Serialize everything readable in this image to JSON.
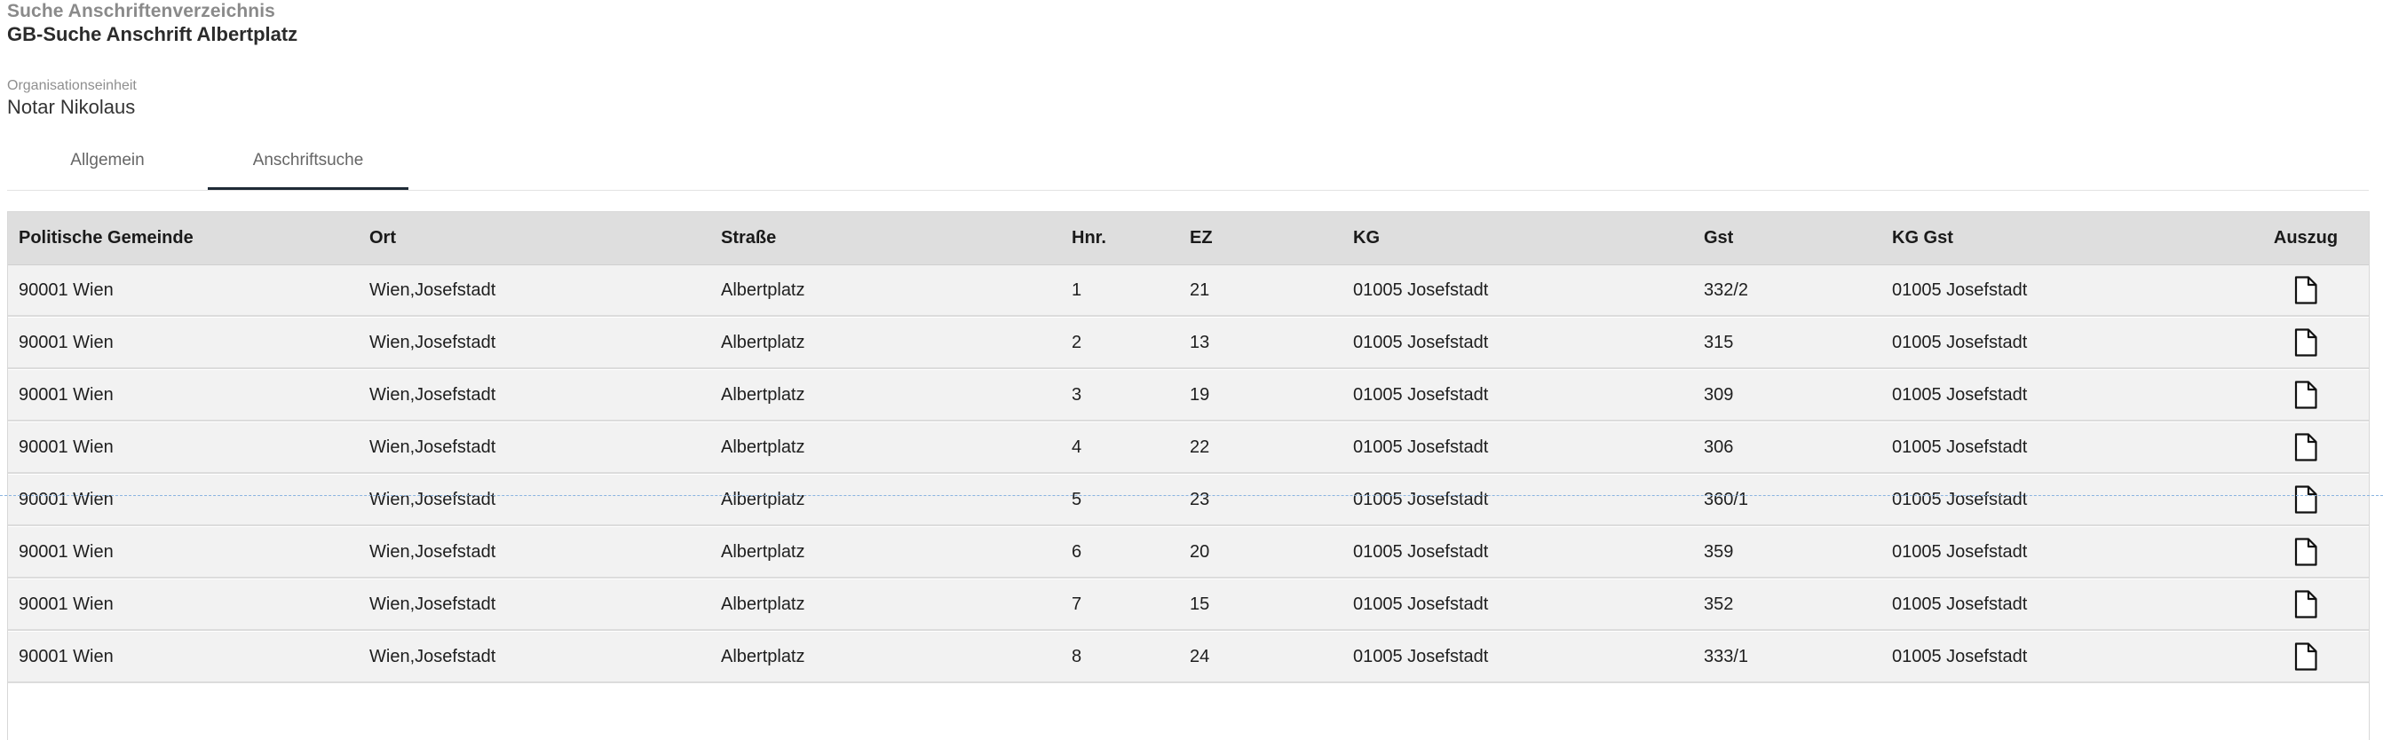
{
  "header": {
    "section": "Suche Anschriftenverzeichnis",
    "title": "GB-Suche Anschrift Albertplatz"
  },
  "org": {
    "label": "Organisationseinheit",
    "value": "Notar Nikolaus"
  },
  "tabs": [
    {
      "label": "Allgemein",
      "active": false
    },
    {
      "label": "Anschriftsuche",
      "active": true
    }
  ],
  "table": {
    "columns": [
      "Politische Gemeinde",
      "Ort",
      "Straße",
      "Hnr.",
      "EZ",
      "KG",
      "Gst",
      "KG Gst",
      "Auszug"
    ],
    "rows": [
      [
        "90001 Wien",
        "Wien,Josefstadt",
        "Albertplatz",
        "1",
        "21",
        "01005 Josefstadt",
        "332/2",
        "01005 Josefstadt"
      ],
      [
        "90001 Wien",
        "Wien,Josefstadt",
        "Albertplatz",
        "2",
        "13",
        "01005 Josefstadt",
        "315",
        "01005 Josefstadt"
      ],
      [
        "90001 Wien",
        "Wien,Josefstadt",
        "Albertplatz",
        "3",
        "19",
        "01005 Josefstadt",
        "309",
        "01005 Josefstadt"
      ],
      [
        "90001 Wien",
        "Wien,Josefstadt",
        "Albertplatz",
        "4",
        "22",
        "01005 Josefstadt",
        "306",
        "01005 Josefstadt"
      ],
      [
        "90001 Wien",
        "Wien,Josefstadt",
        "Albertplatz",
        "5",
        "23",
        "01005 Josefstadt",
        "360/1",
        "01005 Josefstadt"
      ],
      [
        "90001 Wien",
        "Wien,Josefstadt",
        "Albertplatz",
        "6",
        "20",
        "01005 Josefstadt",
        "359",
        "01005 Josefstadt"
      ],
      [
        "90001 Wien",
        "Wien,Josefstadt",
        "Albertplatz",
        "7",
        "15",
        "01005 Josefstadt",
        "352",
        "01005 Josefstadt"
      ],
      [
        "90001 Wien",
        "Wien,Josefstadt",
        "Albertplatz",
        "8",
        "24",
        "01005 Josefstadt",
        "333/1",
        "01005 Josefstadt"
      ]
    ],
    "action_icon": "document-icon"
  },
  "colors": {
    "header_bg": "#dedede",
    "row_bg": "#f2f2f2",
    "tab_active_underline": "#1f2a36"
  }
}
